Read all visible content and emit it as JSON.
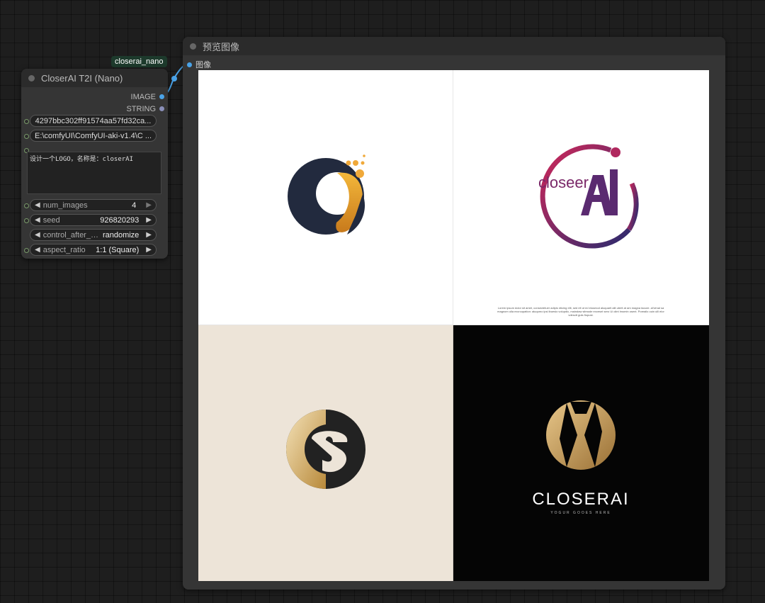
{
  "node1": {
    "badge": "closerai_nano",
    "title": "CloserAI T2I (Nano)",
    "outputs": [
      {
        "label": "IMAGE",
        "color": "#4aa3e8"
      },
      {
        "label": "STRING",
        "color": "#8a8fb8"
      }
    ],
    "api_key": "4297bbc302ff91574aa57fd32ca...",
    "path": "E:\\comfyUI\\ComfyUI-aki-v1.4\\C ...",
    "prompt": "设计一个LOGO，名称是：closerAI",
    "widgets": {
      "num_images": {
        "label": "num_images",
        "value": "4"
      },
      "seed": {
        "label": "seed",
        "value": "926820293"
      },
      "control": {
        "label": "control_after_g ...",
        "value": "randomize"
      },
      "aspect": {
        "label": "aspect_ratio",
        "value": "1:1 (Square)"
      }
    }
  },
  "node2": {
    "title": "预览图像",
    "input_label": "图像",
    "images": [
      {
        "name": "logo-c-swoosh",
        "bg": "#ffffff"
      },
      {
        "name": "logo-closeer-ai",
        "bg": "#ffffff",
        "wordmark_left": "closeer",
        "wordmark_right": "Ai",
        "caption": "Lorem ipsum dolor sit amet, consectetuer adipis nticing elit, sed elt ut ed eiusmod aluquarit alit uterit at am magna taoure. al'vimal sa magnom ulla excrcupation: aluqumo ipsi ibuesio volupdic, maindaw sitmode excesnt sero Ui olint lmomin osent. Poreailo ouin ulli elor vdesctt guts fiopust."
      },
      {
        "name": "logo-s-monogram",
        "bg": "#ede4d8"
      },
      {
        "name": "logo-closerai-gold",
        "bg": "#050505",
        "wordmark": "CLOSERAI",
        "tagline": "YOGUR GOOES HERE"
      }
    ]
  }
}
